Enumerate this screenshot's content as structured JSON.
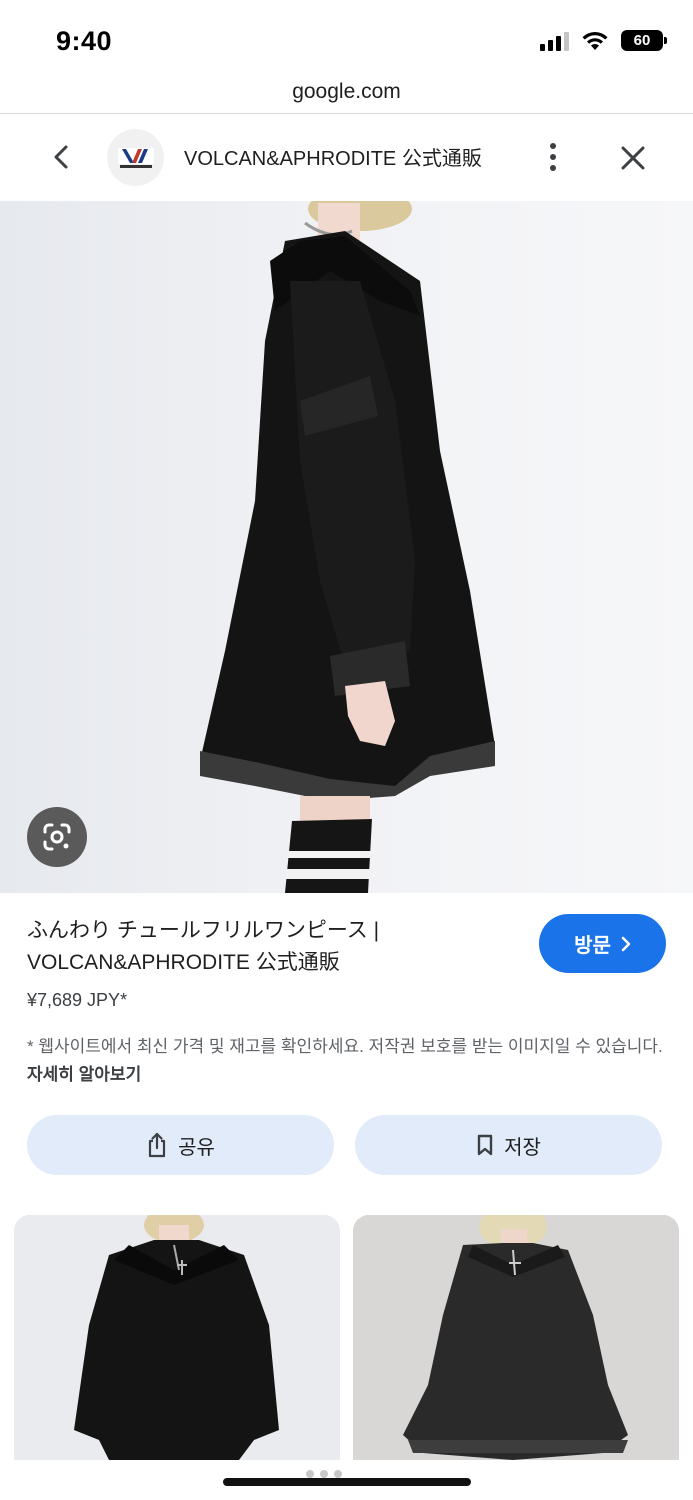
{
  "status": {
    "time": "9:40",
    "battery": "60",
    "icons": [
      "signal-icon",
      "wifi-icon",
      "battery-icon"
    ]
  },
  "url": "google.com",
  "header": {
    "site_name": "VOLCAN&APHRODITE 公式通販",
    "icons": [
      "back-chevron-icon",
      "site-logo",
      "more-vertical-icon",
      "close-icon"
    ]
  },
  "lens": {
    "icon": "google-lens-icon"
  },
  "product": {
    "title_line1": "ふんわり チュールフリルワンピース |",
    "title_line2": "VOLCAN&APHRODITE 公式通販",
    "price": "¥7,689 JPY*",
    "visit_label": "방문",
    "notice": "* 웹사이트에서 최신 가격 및 재고를 확인하세요. 저작권 보호를 받는 이미지일 수 있습니다.",
    "learn_more": "자세히 알아보기"
  },
  "actions": {
    "share_label": "공유",
    "save_label": "저장"
  },
  "colors": {
    "accent": "#1a73e8",
    "action_bg": "#e2ebf9",
    "text": "#1f1f1f",
    "muted": "#5f6368"
  }
}
